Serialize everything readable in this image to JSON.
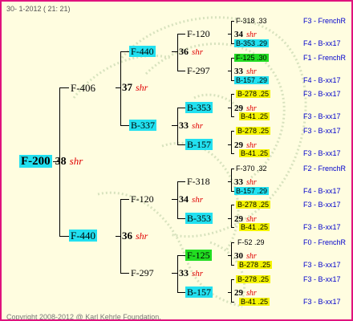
{
  "header": {
    "date_text": "30- 1-2012 ( 21: 21)"
  },
  "footer": {
    "copyright": "Copyright 2008-2012 @ Karl Kehrle Foundation."
  },
  "root": {
    "id": "F-200",
    "pair": "38",
    "shr": "shr"
  },
  "g1": [
    {
      "id": "F-406",
      "pair": "37",
      "shr": "shr"
    },
    {
      "id": "F-440",
      "pair": "36",
      "shr": "shr"
    }
  ],
  "g2": [
    {
      "id": "F-440",
      "pair": "36",
      "shr": "shr"
    },
    {
      "id": "B-337",
      "pair": "33",
      "shr": "shr"
    },
    {
      "id": "F-120",
      "pair": "34",
      "shr": "shr"
    },
    {
      "id": "F-297",
      "pair": "33",
      "shr": "shr"
    }
  ],
  "g3": [
    {
      "id": "F-120",
      "pair": "34",
      "shr": "shr"
    },
    {
      "id": "F-297",
      "pair": "33",
      "shr": "shr"
    },
    {
      "id": "B-353",
      "pair": "29",
      "shr": "shr"
    },
    {
      "id": "B-157",
      "pair": "29",
      "shr": "shr"
    },
    {
      "id": "F-318",
      "pair": "33",
      "shr": "shr"
    },
    {
      "id": "B-353",
      "pair": "29",
      "shr": "shr"
    },
    {
      "id": "F-125",
      "pair": "30",
      "shr": "shr"
    },
    {
      "id": "B-157",
      "pair": "29",
      "shr": "shr"
    }
  ],
  "g4": [
    {
      "id": "F-318",
      "val": ".33",
      "src": "F3 - FrenchR"
    },
    {
      "id": "B-353",
      "val": ".29",
      "src": "F4 - B-xx17"
    },
    {
      "id": "F-125",
      "val": ".30",
      "src": "F1 - FrenchR"
    },
    {
      "id": "B-157",
      "val": ".29",
      "src": "F4 - B-xx17"
    },
    {
      "id": "B-278",
      "val": ".25",
      "src": "F3 - B-xx17"
    },
    {
      "id": "B-41",
      "val": ".25",
      "src": "F3 - B-xx17"
    },
    {
      "id": "B-278",
      "val": ".25",
      "src": "F3 - B-xx17"
    },
    {
      "id": "B-41",
      "val": ".25",
      "src": "F3 - B-xx17"
    },
    {
      "id": "F-370",
      "val": ".32",
      "src": "F2 - FrenchR"
    },
    {
      "id": "B-157",
      "val": ".29",
      "src": "F4 - B-xx17"
    },
    {
      "id": "B-278",
      "val": ".25",
      "src": "F3 - B-xx17"
    },
    {
      "id": "B-41",
      "val": ".25",
      "src": "F3 - B-xx17"
    },
    {
      "id": "F-52",
      "val": ".29",
      "src": "F0 - FrenchR"
    },
    {
      "id": "B-278",
      "val": ".25",
      "src": "F3 - B-xx17"
    },
    {
      "id": "B-278",
      "val": ".25",
      "src": "F3 - B-xx17"
    },
    {
      "id": "B-41",
      "val": ".25",
      "src": "F3 - B-xx17"
    }
  ],
  "colors": {
    "frame": "#e0127e",
    "background": "#fffde0",
    "cyan": "#22e0f0",
    "green": "#22dd22",
    "yellow": "#f4f400",
    "shr": "#e00000",
    "source_text": "#0000cc"
  }
}
